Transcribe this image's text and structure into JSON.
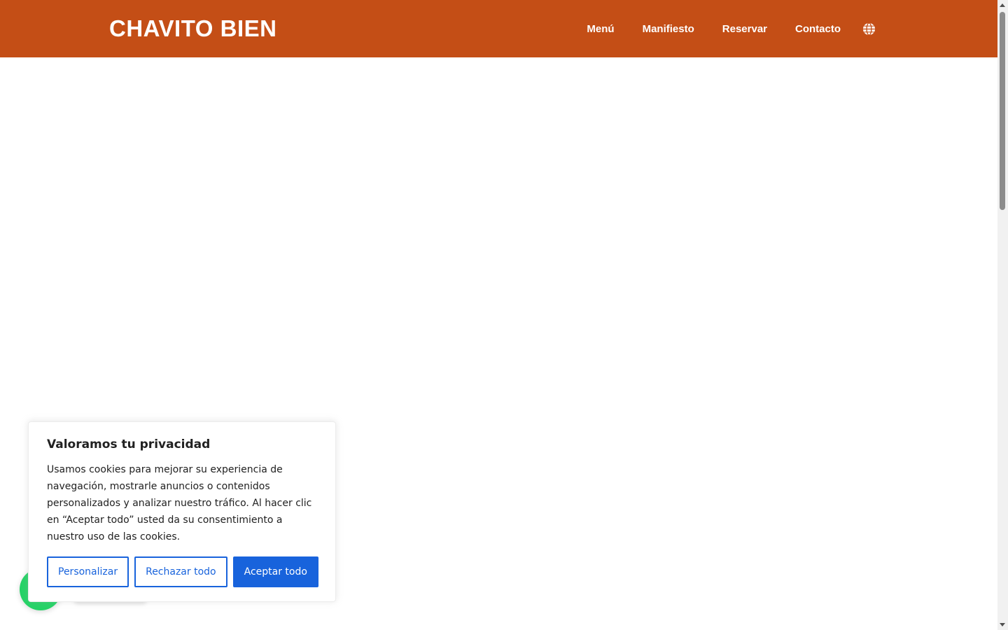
{
  "header": {
    "logo": "CHAVITO BIEN",
    "nav": [
      {
        "label": "Menú"
      },
      {
        "label": "Manifiesto"
      },
      {
        "label": "Reservar"
      },
      {
        "label": "Contacto"
      }
    ],
    "language_icon": "globe-icon"
  },
  "cookie_banner": {
    "title": "Valoramos tu privacidad",
    "text": "Usamos cookies para mejorar su experiencia de navegación, mostrarle anuncios o contenidos personalizados y analizar nuestro tráfico. Al hacer clic en “Aceptar todo” usted da su consentimiento a nuestro uso de las cookies.",
    "customize_label": "Personalizar",
    "reject_label": "Rechazar todo",
    "accept_label": "Aceptar todo"
  },
  "floating": {
    "whatsapp_icon": "whatsapp-icon"
  },
  "colors": {
    "header_bg": "#c44e16",
    "primary_button": "#1863dc",
    "whatsapp": "#25d366"
  }
}
